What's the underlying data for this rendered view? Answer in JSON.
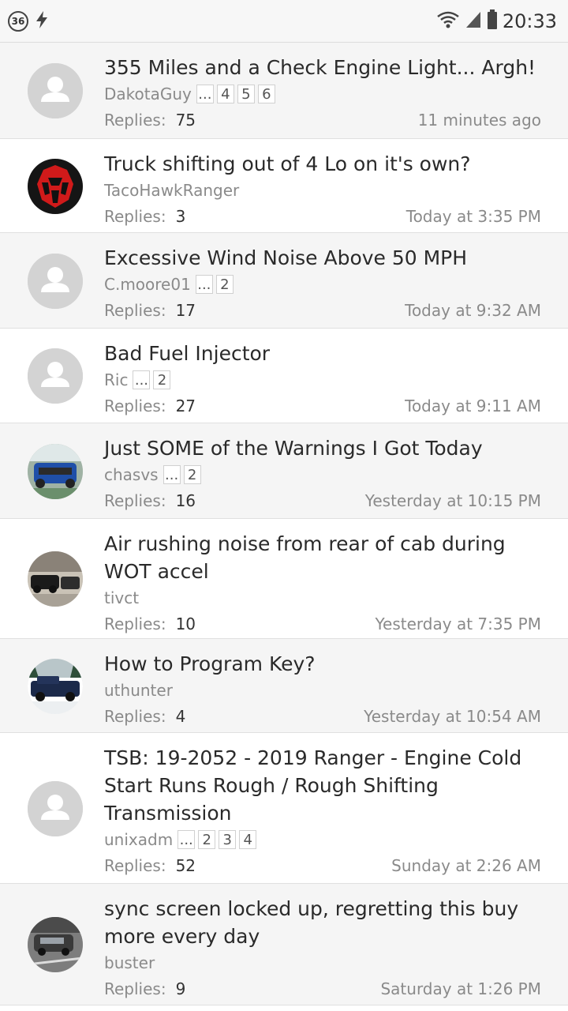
{
  "status_bar": {
    "notification_count": "36",
    "time": "20:33",
    "icons": [
      "notification-count-icon",
      "lightning-icon",
      "wifi-icon",
      "signal-icon",
      "battery-icon"
    ]
  },
  "replies_label": "Replies:",
  "threads": [
    {
      "title": "355 Miles and a Check Engine Light... Argh!",
      "author": "DakotaGuy",
      "pages": [
        "...",
        "4",
        "5",
        "6"
      ],
      "replies": "75",
      "time": "11 minutes ago",
      "avatar": "default"
    },
    {
      "title": "Truck shifting out of 4 Lo on it's own?",
      "author": "TacoHawkRanger",
      "pages": [],
      "replies": "3",
      "time": "Today at 3:35 PM",
      "avatar": "transformer"
    },
    {
      "title": "Excessive Wind Noise Above 50 MPH",
      "author": "C.moore01",
      "pages": [
        "...",
        "2"
      ],
      "replies": "17",
      "time": "Today at 9:32 AM",
      "avatar": "default"
    },
    {
      "title": "Bad Fuel Injector",
      "author": "Ric",
      "pages": [
        "...",
        "2"
      ],
      "replies": "27",
      "time": "Today at 9:11 AM",
      "avatar": "default"
    },
    {
      "title": "Just SOME of the Warnings I Got Today",
      "author": "chasvs",
      "pages": [
        "...",
        "2"
      ],
      "replies": "16",
      "time": "Yesterday at 10:15 PM",
      "avatar": "blue-truck"
    },
    {
      "title": "Air rushing noise from rear of cab during WOT accel",
      "author": "tivct",
      "pages": [],
      "replies": "10",
      "time": "Yesterday at 7:35 PM",
      "avatar": "garage"
    },
    {
      "title": "How to Program Key?",
      "author": "uthunter",
      "pages": [],
      "replies": "4",
      "time": "Yesterday at 10:54 AM",
      "avatar": "snow-truck"
    },
    {
      "title": "TSB: 19-2052 - 2019 Ranger - Engine Cold Start Runs Rough / Rough Shifting Transmission",
      "author": "unixadm",
      "pages": [
        "...",
        "2",
        "3",
        "4"
      ],
      "replies": "52",
      "time": "Sunday at 2:26 AM",
      "avatar": "default"
    },
    {
      "title": "sync screen locked up, regretting this buy more every day",
      "author": "buster",
      "pages": [],
      "replies": "9",
      "time": "Saturday at 1:26 PM",
      "avatar": "parking-lot"
    }
  ]
}
